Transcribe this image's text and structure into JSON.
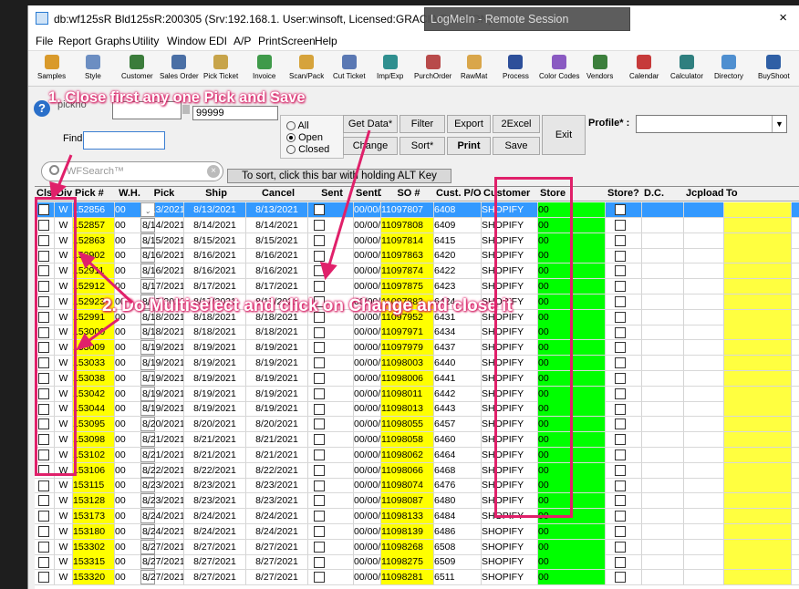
{
  "window": {
    "title": "db:wf125sR Bld125sR:200305 (Srv:192.168.1. User:winsoft, Licensed:GRACIA FASHION)",
    "close": "×"
  },
  "remote": {
    "logo": "LogMeIn",
    "text": "LogMeIn - Remote Session",
    "close": "×"
  },
  "menu": [
    "File",
    "Report",
    "Graphs",
    "Utility",
    "Window",
    "EDI",
    "A/P",
    "PrintScreen",
    "Help"
  ],
  "toolbar": [
    "Samples",
    "Style",
    "Customer",
    "Sales Order",
    "Pick Ticket",
    "Invoice",
    "Scan/Pack",
    "Cut Ticket",
    "Imp/Exp",
    "PurchOrder",
    "RawMat",
    "Process",
    "Color Codes",
    "Vendors",
    "Calendar",
    "Calculator",
    "Directory",
    "BuyShoot"
  ],
  "form": {
    "pickno_label": "pickno",
    "pickno_value": "99999",
    "find_label": "Find",
    "radio_all": "All",
    "radio_open": "Open",
    "radio_closed": "Closed",
    "btn_getdata": "Get Data*",
    "btn_filter": "Filter",
    "btn_export": "Export",
    "btn_2excel": "2Excel",
    "btn_exit": "Exit",
    "btn_change": "Change",
    "btn_sort": "Sort*",
    "btn_print": "Print",
    "btn_save": "Save",
    "profile_label": "Profile* :",
    "search_placeholder": "WFSearch™",
    "sort_hint": "To sort, click this bar with holding ALT Key"
  },
  "grid": {
    "columns": [
      "Clsd",
      "Div",
      "Pick #",
      "W.H.",
      "Pick",
      "Ship",
      "Cancel",
      "Sent",
      "SentDate",
      "SO #",
      "Cust. P/O#",
      "Customer",
      "Store",
      "Store?",
      "D.C.",
      "Jcploadid",
      "To"
    ],
    "rows": [
      [
        "W",
        "152856",
        "00",
        "8/13/2021",
        "8/13/2021",
        "8/13/2021",
        "00/00/00",
        "11097807",
        "6408",
        "SHOPIFY",
        "00"
      ],
      [
        "W",
        "152857",
        "00",
        "8/14/2021",
        "8/14/2021",
        "8/14/2021",
        "00/00/00",
        "11097808",
        "6409",
        "SHOPIFY",
        "00"
      ],
      [
        "W",
        "152863",
        "00",
        "8/15/2021",
        "8/15/2021",
        "8/15/2021",
        "00/00/00",
        "11097814",
        "6415",
        "SHOPIFY",
        "00"
      ],
      [
        "W",
        "152902",
        "00",
        "8/16/2021",
        "8/16/2021",
        "8/16/2021",
        "00/00/00",
        "11097863",
        "6420",
        "SHOPIFY",
        "00"
      ],
      [
        "W",
        "152911",
        "00",
        "8/16/2021",
        "8/16/2021",
        "8/16/2021",
        "00/00/00",
        "11097874",
        "6422",
        "SHOPIFY",
        "00"
      ],
      [
        "W",
        "152912",
        "00",
        "8/17/2021",
        "8/17/2021",
        "8/17/2021",
        "00/00/00",
        "11097875",
        "6423",
        "SHOPIFY",
        "00"
      ],
      [
        "W",
        "152923",
        "00",
        "8/17/2021",
        "8/17/2021",
        "8/17/2021",
        "00/00/00",
        "11097883",
        "6424",
        "SHOPIFY",
        "00"
      ],
      [
        "W",
        "152991",
        "00",
        "8/18/2021",
        "8/18/2021",
        "8/18/2021",
        "00/00/00",
        "11097952",
        "6431",
        "SHOPIFY",
        "00"
      ],
      [
        "W",
        "153000",
        "00",
        "8/18/2021",
        "8/18/2021",
        "8/18/2021",
        "00/00/00",
        "11097971",
        "6434",
        "SHOPIFY",
        "00"
      ],
      [
        "W",
        "153009",
        "00",
        "8/19/2021",
        "8/19/2021",
        "8/19/2021",
        "00/00/00",
        "11097979",
        "6437",
        "SHOPIFY",
        "00"
      ],
      [
        "W",
        "153033",
        "00",
        "8/19/2021",
        "8/19/2021",
        "8/19/2021",
        "00/00/00",
        "11098003",
        "6440",
        "SHOPIFY",
        "00"
      ],
      [
        "W",
        "153038",
        "00",
        "8/19/2021",
        "8/19/2021",
        "8/19/2021",
        "00/00/00",
        "11098006",
        "6441",
        "SHOPIFY",
        "00"
      ],
      [
        "W",
        "153042",
        "00",
        "8/19/2021",
        "8/19/2021",
        "8/19/2021",
        "00/00/00",
        "11098011",
        "6442",
        "SHOPIFY",
        "00"
      ],
      [
        "W",
        "153044",
        "00",
        "8/19/2021",
        "8/19/2021",
        "8/19/2021",
        "00/00/00",
        "11098013",
        "6443",
        "SHOPIFY",
        "00"
      ],
      [
        "W",
        "153095",
        "00",
        "8/20/2021",
        "8/20/2021",
        "8/20/2021",
        "00/00/00",
        "11098055",
        "6457",
        "SHOPIFY",
        "00"
      ],
      [
        "W",
        "153098",
        "00",
        "8/21/2021",
        "8/21/2021",
        "8/21/2021",
        "00/00/00",
        "11098058",
        "6460",
        "SHOPIFY",
        "00"
      ],
      [
        "W",
        "153102",
        "00",
        "8/21/2021",
        "8/21/2021",
        "8/21/2021",
        "00/00/00",
        "11098062",
        "6464",
        "SHOPIFY",
        "00"
      ],
      [
        "W",
        "153106",
        "00",
        "8/22/2021",
        "8/22/2021",
        "8/22/2021",
        "00/00/00",
        "11098066",
        "6468",
        "SHOPIFY",
        "00"
      ],
      [
        "W",
        "153115",
        "00",
        "8/23/2021",
        "8/23/2021",
        "8/23/2021",
        "00/00/00",
        "11098074",
        "6476",
        "SHOPIFY",
        "00"
      ],
      [
        "W",
        "153128",
        "00",
        "8/23/2021",
        "8/23/2021",
        "8/23/2021",
        "00/00/00",
        "11098087",
        "6480",
        "SHOPIFY",
        "00"
      ],
      [
        "W",
        "153173",
        "00",
        "8/24/2021",
        "8/24/2021",
        "8/24/2021",
        "00/00/00",
        "11098133",
        "6484",
        "SHOPIFY",
        "00"
      ],
      [
        "W",
        "153180",
        "00",
        "8/24/2021",
        "8/24/2021",
        "8/24/2021",
        "00/00/00",
        "11098139",
        "6486",
        "SHOPIFY",
        "00"
      ],
      [
        "W",
        "153302",
        "00",
        "8/27/2021",
        "8/27/2021",
        "8/27/2021",
        "00/00/00",
        "11098268",
        "6508",
        "SHOPIFY",
        "00"
      ],
      [
        "W",
        "153315",
        "00",
        "8/27/2021",
        "8/27/2021",
        "8/27/2021",
        "00/00/00",
        "11098275",
        "6509",
        "SHOPIFY",
        "00"
      ],
      [
        "W",
        "153320",
        "00",
        "8/27/2021",
        "8/27/2021",
        "8/27/2021",
        "00/00/00",
        "11098281",
        "6511",
        "SHOPIFY",
        "00"
      ]
    ]
  },
  "annotations": {
    "step1": "1. Close first any one Pick and Save",
    "step2": "2. Do Multiselect and click on Change and close it",
    "color": "#e0206a"
  }
}
